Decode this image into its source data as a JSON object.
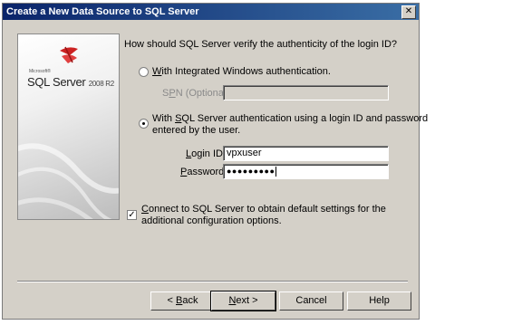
{
  "dialog": {
    "title": "Create a New Data Source to SQL Server",
    "close_glyph": "✕"
  },
  "banner": {
    "brand_small": "Microsoft®",
    "brand": "SQL Server",
    "version": "2008 R2"
  },
  "question": "How should SQL Server verify the authenticity of the login ID?",
  "auth": {
    "windows_label_pre": "",
    "windows_label_hotkey": "W",
    "windows_label_post": "ith Integrated Windows authentication.",
    "spn_label_pre": "S",
    "spn_label_hotkey": "P",
    "spn_label_post": "N (Optional):",
    "spn_value": "",
    "sql_label_pre": "With ",
    "sql_label_hotkey": "S",
    "sql_label_post": "QL Server authentication using a login ID and password",
    "sql_label_line2": "entered by the user.",
    "selected": "sql"
  },
  "credentials": {
    "login_label_hotkey": "L",
    "login_label_post": "ogin ID:",
    "login_value": "vpxuser",
    "password_label_hotkey": "P",
    "password_label_post": "assword:",
    "password_value": "●●●●●●●●●"
  },
  "connect_option": {
    "checked": true,
    "check_glyph": "✓",
    "label_hotkey": "C",
    "label_post": "onnect to SQL Server to obtain default settings for the",
    "label_line2": "additional configuration options."
  },
  "buttons": {
    "back_pre": "< ",
    "back_hotkey": "B",
    "back_post": "ack",
    "next_hotkey": "N",
    "next_post": "ext >",
    "cancel": "Cancel",
    "help": "Help"
  },
  "icons": {
    "logo": "sql-server-logo-icon",
    "close": "close-icon"
  }
}
